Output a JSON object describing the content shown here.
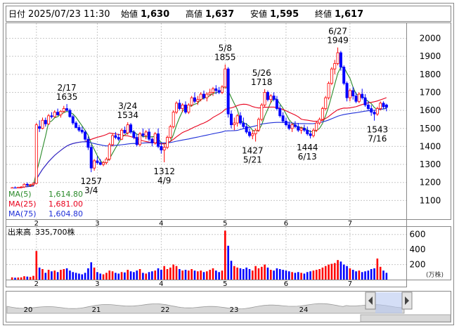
{
  "header": {
    "date_label": "日付",
    "datetime": "2025/07/23 11:30",
    "open_label": "始値",
    "open": "1,630",
    "high_label": "高値",
    "high": "1,637",
    "low_label": "安値",
    "low": "1,595",
    "close_label": "終値",
    "close": "1,617"
  },
  "colors": {
    "up": "#ff0000",
    "down": "#0000ff",
    "ma5": "#2a8a2a",
    "ma25": "#e8001c",
    "ma75": "#1f2fd8",
    "grid": "#c8c8c8",
    "high_value": "#e8001c",
    "low_value": "#1a7f1a"
  },
  "legend": [
    {
      "label": "MA(5)",
      "value": "1,614.80"
    },
    {
      "label": "MA(25)",
      "value": "1,681.00"
    },
    {
      "label": "MA(75)",
      "value": "1,604.80"
    }
  ],
  "volume_label": "出来高",
  "volume_value": "335,700株",
  "volume_unit": "(万株)",
  "navigator_labels": [
    "20",
    "21",
    "22",
    "23",
    "24"
  ],
  "chart_data": {
    "type": "candlestick",
    "price_axis": {
      "min": 1000,
      "max": 2080,
      "ticks": [
        1100,
        1200,
        1300,
        1400,
        1500,
        1600,
        1700,
        1800,
        1900,
        2000
      ]
    },
    "volume_axis": {
      "min": 0,
      "max": 700,
      "ticks": [
        200,
        400,
        600
      ]
    },
    "month_labels": [
      {
        "label": "2",
        "index": 8
      },
      {
        "label": "3",
        "index": 28
      },
      {
        "label": "4",
        "index": 49
      },
      {
        "label": "5",
        "index": 70
      },
      {
        "label": "6",
        "index": 90
      },
      {
        "label": "7",
        "index": 111
      }
    ],
    "annotations": [
      {
        "date": "2/17",
        "price": "1635",
        "type": "high",
        "index": 18
      },
      {
        "date": "3/4",
        "price": "1257",
        "type": "low",
        "index": 26
      },
      {
        "date": "3/24",
        "price": "1534",
        "type": "high",
        "index": 38
      },
      {
        "date": "4/9",
        "price": "1312",
        "type": "low",
        "index": 50
      },
      {
        "date": "5/8",
        "price": "1855",
        "type": "high",
        "index": 70
      },
      {
        "date": "5/21",
        "price": "1427",
        "type": "low",
        "index": 79
      },
      {
        "date": "5/26",
        "price": "1718",
        "type": "high",
        "index": 82
      },
      {
        "date": "6/13",
        "price": "1444",
        "type": "low",
        "index": 97
      },
      {
        "date": "6/27",
        "price": "1949",
        "type": "high",
        "index": 107
      },
      {
        "date": "7/16",
        "price": "1543",
        "type": "low",
        "index": 120
      }
    ],
    "candles": [
      [
        1165,
        1175,
        1160,
        1170,
        30
      ],
      [
        1170,
        1178,
        1162,
        1168,
        25
      ],
      [
        1168,
        1176,
        1160,
        1172,
        28
      ],
      [
        1172,
        1180,
        1165,
        1175,
        30
      ],
      [
        1175,
        1195,
        1170,
        1190,
        45
      ],
      [
        1190,
        1200,
        1180,
        1185,
        40
      ],
      [
        1185,
        1192,
        1175,
        1188,
        35
      ],
      [
        1188,
        1200,
        1182,
        1195,
        50
      ],
      [
        1195,
        1530,
        1190,
        1520,
        380
      ],
      [
        1510,
        1545,
        1480,
        1500,
        160
      ],
      [
        1500,
        1560,
        1495,
        1545,
        140
      ],
      [
        1545,
        1560,
        1510,
        1525,
        90
      ],
      [
        1525,
        1580,
        1520,
        1570,
        130
      ],
      [
        1570,
        1590,
        1555,
        1565,
        110
      ],
      [
        1565,
        1600,
        1560,
        1590,
        120
      ],
      [
        1590,
        1610,
        1570,
        1575,
        100
      ],
      [
        1575,
        1600,
        1560,
        1595,
        130
      ],
      [
        1595,
        1625,
        1585,
        1610,
        140
      ],
      [
        1610,
        1635,
        1595,
        1600,
        150
      ],
      [
        1600,
        1610,
        1560,
        1565,
        120
      ],
      [
        1565,
        1575,
        1520,
        1530,
        100
      ],
      [
        1530,
        1540,
        1500,
        1505,
        90
      ],
      [
        1505,
        1520,
        1480,
        1490,
        80
      ],
      [
        1490,
        1510,
        1470,
        1480,
        70
      ],
      [
        1480,
        1490,
        1430,
        1440,
        90
      ],
      [
        1440,
        1455,
        1380,
        1395,
        150
      ],
      [
        1395,
        1410,
        1257,
        1280,
        230
      ],
      [
        1280,
        1330,
        1265,
        1320,
        160
      ],
      [
        1320,
        1345,
        1300,
        1310,
        100
      ],
      [
        1310,
        1330,
        1295,
        1300,
        80
      ],
      [
        1300,
        1320,
        1290,
        1310,
        70
      ],
      [
        1310,
        1340,
        1300,
        1330,
        90
      ],
      [
        1330,
        1420,
        1320,
        1410,
        120
      ],
      [
        1410,
        1470,
        1400,
        1460,
        110
      ],
      [
        1460,
        1480,
        1440,
        1450,
        90
      ],
      [
        1450,
        1470,
        1430,
        1440,
        80
      ],
      [
        1440,
        1500,
        1435,
        1490,
        100
      ],
      [
        1490,
        1510,
        1470,
        1475,
        95
      ],
      [
        1475,
        1534,
        1465,
        1520,
        130
      ],
      [
        1520,
        1530,
        1470,
        1480,
        110
      ],
      [
        1480,
        1490,
        1440,
        1450,
        100
      ],
      [
        1450,
        1470,
        1400,
        1410,
        120
      ],
      [
        1410,
        1480,
        1400,
        1470,
        140
      ],
      [
        1470,
        1500,
        1450,
        1460,
        90
      ],
      [
        1460,
        1490,
        1440,
        1480,
        80
      ],
      [
        1480,
        1500,
        1430,
        1440,
        100
      ],
      [
        1440,
        1450,
        1400,
        1420,
        110
      ],
      [
        1420,
        1480,
        1410,
        1470,
        120
      ],
      [
        1470,
        1500,
        1390,
        1400,
        150
      ],
      [
        1400,
        1420,
        1360,
        1380,
        130
      ],
      [
        1380,
        1410,
        1312,
        1395,
        180
      ],
      [
        1395,
        1460,
        1385,
        1450,
        140
      ],
      [
        1450,
        1520,
        1440,
        1510,
        160
      ],
      [
        1510,
        1600,
        1500,
        1590,
        200
      ],
      [
        1590,
        1650,
        1580,
        1640,
        180
      ],
      [
        1640,
        1660,
        1600,
        1610,
        140
      ],
      [
        1610,
        1640,
        1590,
        1630,
        120
      ],
      [
        1630,
        1650,
        1580,
        1590,
        130
      ],
      [
        1590,
        1640,
        1580,
        1630,
        120
      ],
      [
        1630,
        1680,
        1620,
        1670,
        140
      ],
      [
        1670,
        1700,
        1640,
        1650,
        120
      ],
      [
        1650,
        1680,
        1630,
        1660,
        110
      ],
      [
        1660,
        1700,
        1650,
        1690,
        120
      ],
      [
        1690,
        1710,
        1660,
        1670,
        100
      ],
      [
        1670,
        1700,
        1650,
        1690,
        110
      ],
      [
        1690,
        1720,
        1680,
        1700,
        130
      ],
      [
        1700,
        1730,
        1680,
        1720,
        150
      ],
      [
        1720,
        1740,
        1690,
        1710,
        120
      ],
      [
        1710,
        1730,
        1690,
        1700,
        100
      ],
      [
        1700,
        1740,
        1690,
        1730,
        120
      ],
      [
        1730,
        1855,
        1720,
        1830,
        650
      ],
      [
        1830,
        1840,
        1560,
        1580,
        450
      ],
      [
        1580,
        1600,
        1500,
        1520,
        250
      ],
      [
        1520,
        1560,
        1490,
        1530,
        180
      ],
      [
        1530,
        1580,
        1510,
        1570,
        160
      ],
      [
        1570,
        1590,
        1520,
        1530,
        150
      ],
      [
        1530,
        1560,
        1500,
        1510,
        140
      ],
      [
        1510,
        1530,
        1470,
        1480,
        160
      ],
      [
        1480,
        1500,
        1450,
        1460,
        140
      ],
      [
        1460,
        1490,
        1440,
        1470,
        120
      ],
      [
        1470,
        1500,
        1427,
        1490,
        180
      ],
      [
        1490,
        1560,
        1480,
        1550,
        150
      ],
      [
        1550,
        1640,
        1540,
        1630,
        170
      ],
      [
        1630,
        1718,
        1620,
        1700,
        200
      ],
      [
        1700,
        1710,
        1650,
        1660,
        160
      ],
      [
        1660,
        1690,
        1640,
        1680,
        130
      ],
      [
        1680,
        1700,
        1650,
        1660,
        120
      ],
      [
        1660,
        1680,
        1600,
        1610,
        150
      ],
      [
        1610,
        1630,
        1560,
        1570,
        140
      ],
      [
        1570,
        1590,
        1530,
        1540,
        130
      ],
      [
        1540,
        1560,
        1510,
        1520,
        120
      ],
      [
        1520,
        1540,
        1490,
        1500,
        110
      ],
      [
        1500,
        1530,
        1480,
        1520,
        100
      ],
      [
        1520,
        1540,
        1500,
        1510,
        90
      ],
      [
        1510,
        1530,
        1480,
        1490,
        100
      ],
      [
        1490,
        1510,
        1470,
        1500,
        90
      ],
      [
        1500,
        1520,
        1480,
        1490,
        80
      ],
      [
        1490,
        1510,
        1460,
        1470,
        100
      ],
      [
        1470,
        1490,
        1444,
        1460,
        110
      ],
      [
        1460,
        1500,
        1450,
        1490,
        120
      ],
      [
        1490,
        1540,
        1480,
        1530,
        130
      ],
      [
        1530,
        1560,
        1520,
        1550,
        140
      ],
      [
        1550,
        1620,
        1540,
        1610,
        160
      ],
      [
        1610,
        1680,
        1600,
        1670,
        180
      ],
      [
        1670,
        1760,
        1660,
        1750,
        200
      ],
      [
        1750,
        1840,
        1740,
        1830,
        210
      ],
      [
        1830,
        1880,
        1800,
        1860,
        220
      ],
      [
        1860,
        1949,
        1850,
        1920,
        260
      ],
      [
        1920,
        1930,
        1820,
        1840,
        240
      ],
      [
        1840,
        1850,
        1740,
        1750,
        200
      ],
      [
        1750,
        1760,
        1650,
        1670,
        180
      ],
      [
        1670,
        1720,
        1650,
        1710,
        150
      ],
      [
        1710,
        1730,
        1660,
        1680,
        130
      ],
      [
        1680,
        1700,
        1640,
        1650,
        110
      ],
      [
        1650,
        1700,
        1640,
        1690,
        120
      ],
      [
        1690,
        1720,
        1660,
        1670,
        100
      ],
      [
        1670,
        1690,
        1620,
        1630,
        110
      ],
      [
        1630,
        1650,
        1600,
        1610,
        120
      ],
      [
        1610,
        1630,
        1570,
        1590,
        140
      ],
      [
        1590,
        1600,
        1543,
        1580,
        150
      ],
      [
        1580,
        1620,
        1570,
        1610,
        280
      ],
      [
        1610,
        1650,
        1600,
        1640,
        170
      ],
      [
        1640,
        1650,
        1610,
        1620,
        120
      ],
      [
        1630,
        1637,
        1595,
        1617,
        90
      ]
    ]
  }
}
